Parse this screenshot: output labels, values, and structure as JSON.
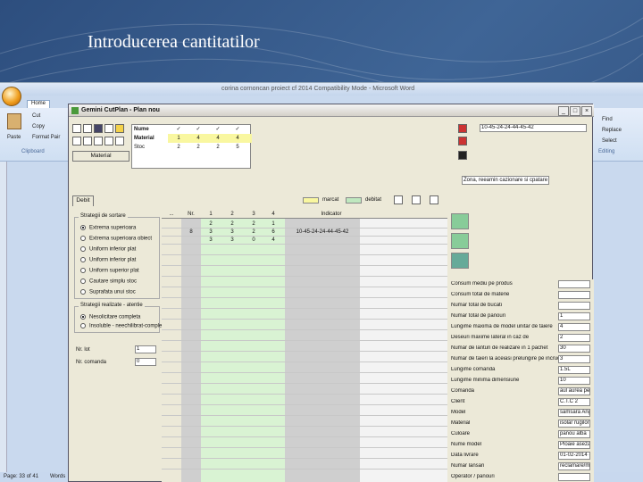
{
  "slide": {
    "title": "Introducerea cantitatilor"
  },
  "word": {
    "window_title": "corina cornoncan proiect cf 2014  Compatibility Mode - Microsoft Word",
    "tab_home": "Home",
    "ribbon": {
      "cut": "Cut",
      "copy": "Copy",
      "format_painter": "Format Pair",
      "paste": "Paste",
      "clipboard": "Clipboard",
      "find": "Find",
      "replace": "Replace",
      "select": "Select",
      "editing": "Editing"
    },
    "status": {
      "page": "Page: 33 of 41",
      "words": "Words"
    }
  },
  "cutplan": {
    "title": "Gemini CutPlan - Plan nou",
    "header_table": {
      "rows": [
        {
          "label": "Nume",
          "values": [
            "✓",
            "✓",
            "✓",
            "✓"
          ]
        },
        {
          "label": "Material",
          "values": [
            "1",
            "4",
            "4",
            "4"
          ]
        },
        {
          "label": "Stoc",
          "values": [
            "2",
            "2",
            "2",
            "5"
          ]
        }
      ]
    },
    "material_button": "Material",
    "panel_ref": "10-45-24-24-44-45-42",
    "rebut_label": "Zona, reeamin cazionare si cpatare",
    "tab": "Debit",
    "legend": {
      "marcat": "marcat",
      "debitat": "debitat"
    },
    "strategy": {
      "title": "Strategii de sortare",
      "options": [
        "Extrema superioara",
        "Extrema superioara obiect",
        "Uniform inferior plat",
        "Uniform inferior plat",
        "Uniform superior plat",
        "Cautare simplu stoc",
        "Suprafata unui stoc"
      ],
      "selected": 0
    },
    "strategy2": {
      "title": "Strategii realizate - atentie",
      "options": [
        "Nesolicitare completa",
        "Insoluble - neechilibrat-completat"
      ],
      "selected": 0
    },
    "fields": [
      {
        "label": "Nr. lot",
        "value": "1"
      },
      {
        "label": "Nr. comanda",
        "value": "0"
      }
    ],
    "grid": {
      "headers": [
        "...",
        "Nr.",
        "1",
        "2",
        "3",
        "4",
        "Indicator"
      ],
      "rows": [
        [
          "",
          "",
          "2",
          "2",
          "2",
          "1",
          ""
        ],
        [
          "",
          "8",
          "3",
          "3",
          "2",
          "6",
          "10-45-24-24-44-45-42"
        ],
        [
          "",
          "",
          "3",
          "3",
          "0",
          "4",
          ""
        ]
      ]
    },
    "right_props": [
      {
        "label": "Consum mediu pe produs",
        "value": ""
      },
      {
        "label": "Consum total de materie",
        "value": ""
      },
      {
        "label": "Numar total de bucati",
        "value": ""
      },
      {
        "label": "Numar total de panouri",
        "value": "1"
      },
      {
        "label": "Lungime maxima de model unitar de taiere",
        "value": "4"
      },
      {
        "label": "Deseuri maxime lateral in caz de",
        "value": "2"
      },
      {
        "label": "Numar de lanturi de realizare in 1 pachet",
        "value": "30"
      },
      {
        "label": "Numar de taieri la aceiasi prelungire pe incrucisari",
        "value": "3"
      },
      {
        "label": "Lungime comanda",
        "value": "1.5L"
      },
      {
        "label": "Lungime minima dimensiune",
        "value": "10"
      },
      {
        "label": "Comanda",
        "value": "aul aurea pe dio/statusii"
      },
      {
        "label": "Client",
        "value": "C.T.C 2"
      },
      {
        "label": "Model",
        "value": "samsara Angela baaza"
      },
      {
        "label": "Material",
        "value": "isolar rugilor rimprezare"
      },
      {
        "label": "Culoare",
        "value": "panou alba"
      },
      {
        "label": "Nume model",
        "value": "Ploaie asezare lemn _ plataforme"
      },
      {
        "label": "Data livrare",
        "value": "01-02-2014 - 20:00"
      },
      {
        "label": "Numar lansari",
        "value": "reclamare/mesaj"
      },
      {
        "label": "Operator / panouri",
        "value": ""
      }
    ]
  }
}
